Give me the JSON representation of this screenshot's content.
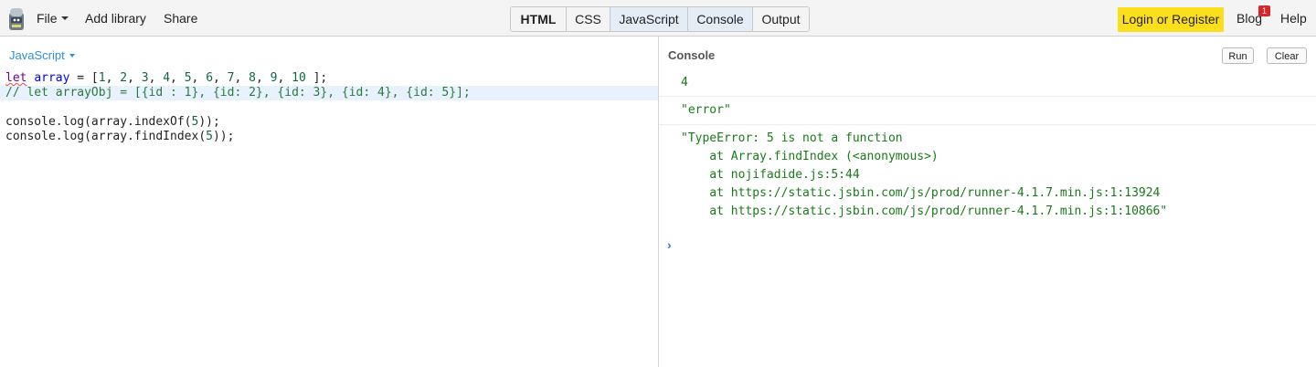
{
  "menu": {
    "file": "File",
    "add_library": "Add library",
    "share": "Share"
  },
  "panels": [
    "HTML",
    "CSS",
    "JavaScript",
    "Console",
    "Output"
  ],
  "login": "Login or Register",
  "blog": "Blog",
  "blog_badge": "1",
  "help": "Help",
  "editor": {
    "language": "JavaScript",
    "lines": [
      "let array = [1, 2, 3, 4, 5, 6, 7, 8, 9, 10 ];",
      "// let arrayObj = [{id : 1}, {id: 2}, {id: 3}, {id: 4}, {id: 5}];",
      "",
      "console.log(array.indexOf(5));",
      "console.log(array.findIndex(5));"
    ]
  },
  "console": {
    "title": "Console",
    "run": "Run",
    "clear": "Clear",
    "outputs": [
      "4",
      "\"error\"",
      "\"TypeError: 5 is not a function\n    at Array.findIndex (<anonymous>)\n    at nojifadide.js:5:44\n    at https://static.jsbin.com/js/prod/runner-4.1.7.min.js:1:13924\n    at https://static.jsbin.com/js/prod/runner-4.1.7.min.js:1:10866\""
    ],
    "prompt": "›"
  },
  "colors": {
    "login_bg": "#fcdf1c",
    "active_panel": "#e4ecf6",
    "lang_link": "#2c8fd8",
    "console_output": "#1a7a1a"
  }
}
